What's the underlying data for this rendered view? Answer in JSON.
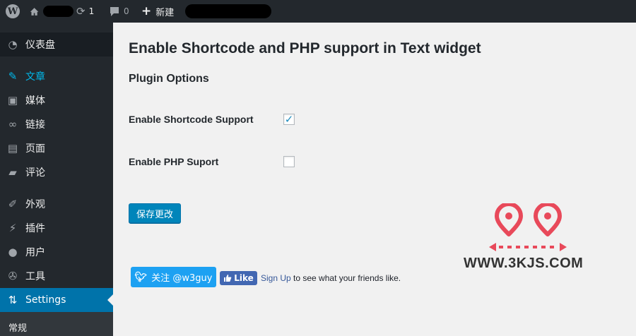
{
  "adminbar": {
    "wp_logo_icon": "wordpress-icon",
    "home_icon": "home-icon",
    "updates_icon": "refresh-icon",
    "updates_count": "1",
    "comments_icon": "comment-icon",
    "comments_count": "0",
    "new_icon": "plus-icon",
    "new_label": "新建"
  },
  "sidebar": {
    "items": [
      {
        "label": "仪表盘",
        "icon": "dashboard-icon"
      },
      {
        "label": "文章",
        "icon": "pin-icon"
      },
      {
        "label": "媒体",
        "icon": "media-icon"
      },
      {
        "label": "链接",
        "icon": "link-icon"
      },
      {
        "label": "页面",
        "icon": "page-icon"
      },
      {
        "label": "评论",
        "icon": "comment-icon"
      },
      {
        "label": "外观",
        "icon": "brush-icon"
      },
      {
        "label": "插件",
        "icon": "plugin-icon"
      },
      {
        "label": "用户",
        "icon": "user-icon"
      },
      {
        "label": "工具",
        "icon": "wrench-icon"
      },
      {
        "label": "Settings",
        "icon": "settings-icon"
      }
    ],
    "submenu_label": "常规"
  },
  "main": {
    "title": "Enable Shortcode and PHP support in Text widget",
    "section_title": "Plugin Options",
    "options": [
      {
        "label": "Enable Shortcode Support",
        "checked": true
      },
      {
        "label": "Enable PHP Suport",
        "checked": false
      }
    ],
    "save_label": "保存更改",
    "check_glyph": "✓"
  },
  "social": {
    "twitter_label": "关注 @w3guy",
    "fb_like_label": "Like",
    "fb_signup_link": "Sign Up",
    "fb_signup_text": " to see what your friends like."
  },
  "watermark": {
    "text": "WWW.3KJS.COM",
    "accent_color": "#e8495a"
  },
  "colors": {
    "adminbar_bg": "#23282d",
    "active_menu_bg": "#0073aa",
    "posts_highlight": "#00b9eb",
    "button_primary": "#0085ba",
    "twitter_blue": "#1da1f2",
    "facebook_blue": "#4267b2"
  }
}
